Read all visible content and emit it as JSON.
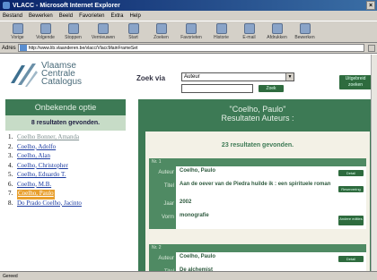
{
  "window": {
    "title": "VLACC - Microsoft Internet Explorer",
    "close_glyph": "×"
  },
  "menu": [
    "Bestand",
    "Bewerken",
    "Beeld",
    "Favorieten",
    "Extra",
    "Help"
  ],
  "toolbar": [
    "Vorige",
    "Volgende",
    "Stoppen",
    "Vernieuwen",
    "Start",
    "Zoeken",
    "Favorieten",
    "Historie",
    "E-mail",
    "Afdrukken",
    "Bewerken"
  ],
  "address": {
    "label": "Adres",
    "url": "http://www.lib.vlaanderen.be/vlacc/VlaccMainFrameSet"
  },
  "logo": {
    "line1": "Vlaamse",
    "line2": "Centrale",
    "line3": "Catalogus"
  },
  "search": {
    "label": "Zoek via",
    "selected": "Auteur",
    "button": "Zoek",
    "advanced_button": "Uitgebreid zoeken"
  },
  "left": {
    "title": "Onbekende optie",
    "results": "8 resultaten gevonden.",
    "items": [
      {
        "num": "1.",
        "label": "Coelho Bonner, Amanda"
      },
      {
        "num": "2.",
        "label": "Coelho, Adolfo"
      },
      {
        "num": "3.",
        "label": "Coelho, Alan"
      },
      {
        "num": "4.",
        "label": "Coelho, Christopher"
      },
      {
        "num": "5.",
        "label": "Coelho, Eduardo T."
      },
      {
        "num": "6.",
        "label": "Coelho, M.B."
      },
      {
        "num": "7.",
        "label": "Coelho, Paulo"
      },
      {
        "num": "8.",
        "label": "Do Prado Coelho, Jacinto"
      }
    ],
    "pager": "1"
  },
  "right": {
    "query": "\"Coelho, Paulo\"",
    "title": "Resultaten Auteurs :",
    "results": "23 resultaten gevonden.",
    "records": [
      {
        "nr": "Nr. 1",
        "auteur_key": "Auteur",
        "auteur": "Coelho, Paulo",
        "titel_key": "Titel",
        "titel": "Aan de oever van de Piedra huilde ik : een spirituele roman",
        "jaar_key": "Jaar",
        "jaar": "2002",
        "vorm_key": "Vorm",
        "vorm": "monografie",
        "btn_detail": "Detail",
        "btn_reg": "Reservering",
        "btn_other": "Andere edities"
      },
      {
        "nr": "Nr. 2",
        "auteur_key": "Auteur",
        "auteur": "Coelho, Paulo",
        "titel_key": "Titel",
        "titel": "De alchemist",
        "btn_detail": "Detail"
      }
    ]
  },
  "status": "Gereed"
}
